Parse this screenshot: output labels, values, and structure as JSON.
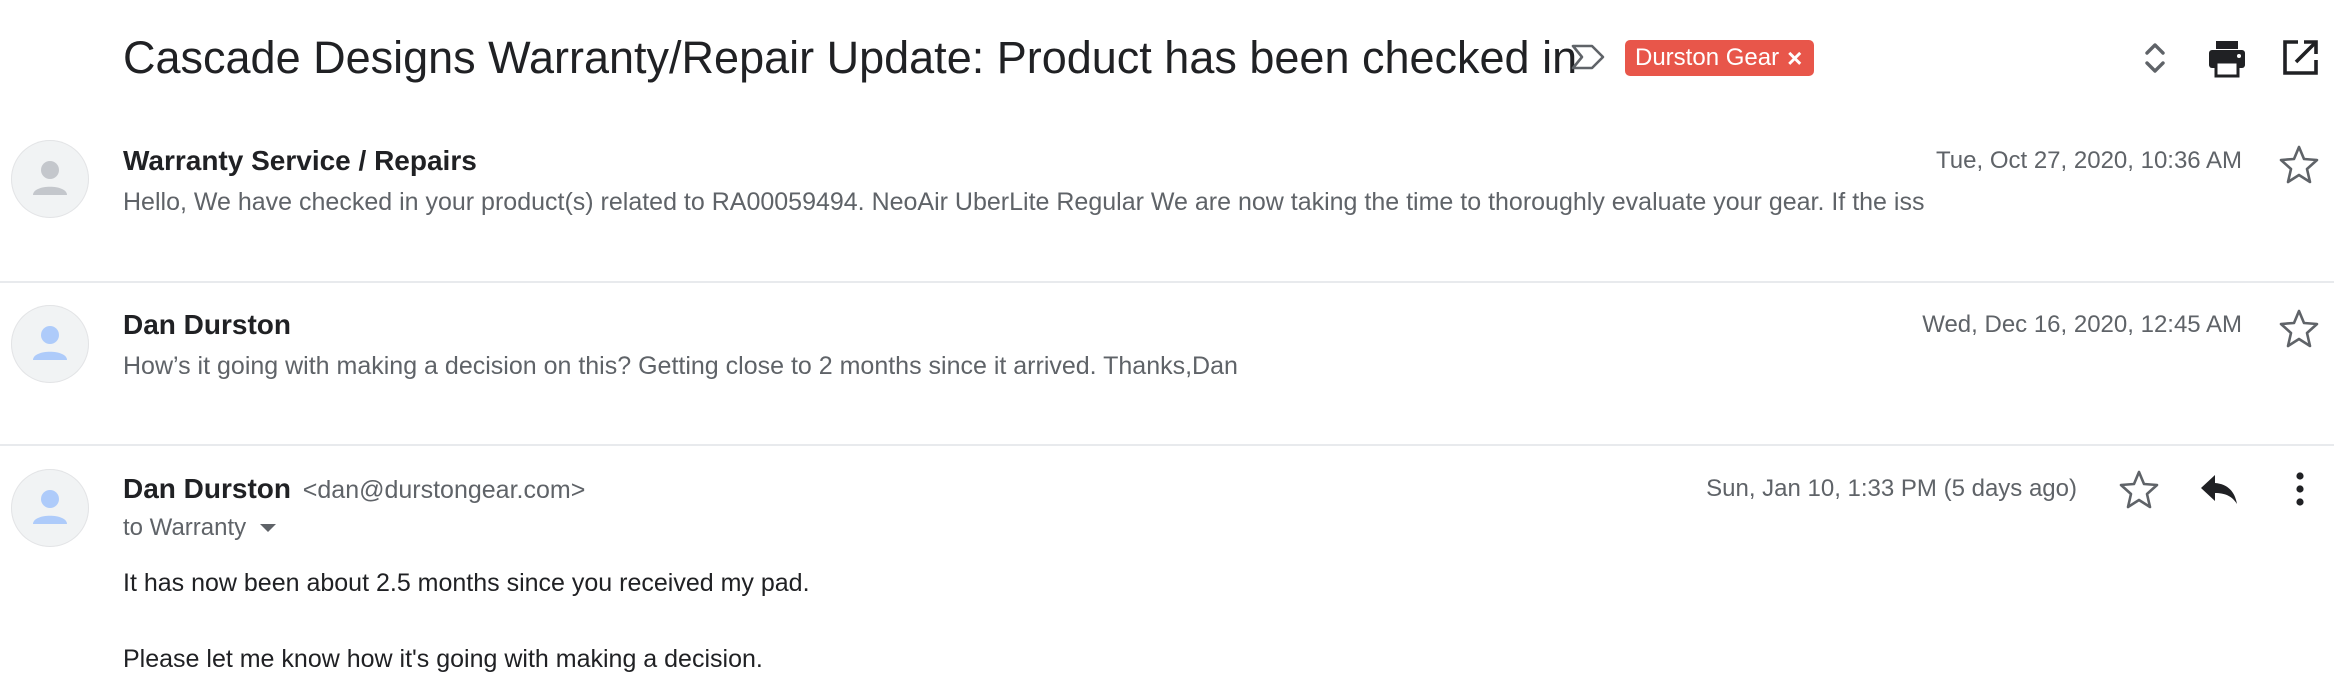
{
  "thread": {
    "subject": "Cascade Designs Warranty/Repair Update: Product has been checked in",
    "label": "Durston Gear",
    "label_close": "×",
    "label_color": "#e8564a",
    "icons": [
      "label-outline-icon",
      "expand-collapse-icon",
      "print-icon",
      "open-in-new-window-icon"
    ]
  },
  "messages": [
    {
      "sender": "Warranty Service / Repairs",
      "date": "Tue, Oct 27, 2020, 10:36 AM",
      "snippet": "Hello, We have checked in your product(s) related to RA00059494. NeoAir UberLite Regular We are now taking the time to thoroughly evaluate your gear. If the iss"
    },
    {
      "sender": "Dan Durston",
      "date": "Wed, Dec 16, 2020, 12:45 AM",
      "snippet": "How’s it going with making a decision on this? Getting close to 2 months since it arrived. Thanks,Dan"
    },
    {
      "sender": "Dan Durston",
      "email": "<dan@durstongear.com>",
      "date": "Sun, Jan 10, 1:33 PM (5 days ago)",
      "to": "to Warranty",
      "body": [
        "It has now been about 2.5 months since you received my pad.",
        "Please let me know how it's going with making a decision."
      ]
    }
  ],
  "colors": {
    "avatar_bg": "#f1f3f4",
    "avatar_person_gray": "#c4c7cc",
    "avatar_person_blue": "#aecbfa",
    "divider": "#e8eaed"
  }
}
